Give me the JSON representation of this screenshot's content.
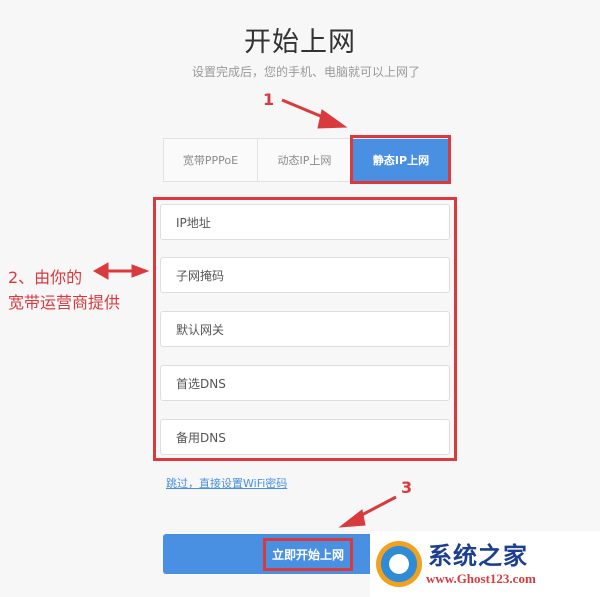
{
  "header": {
    "title": "开始上网",
    "subtitle": "设置完成后，您的手机、电脑就可以上网了"
  },
  "tabs": [
    {
      "label": "宽带PPPoE",
      "active": false
    },
    {
      "label": "动态IP上网",
      "active": false
    },
    {
      "label": "静态IP上网",
      "active": true
    }
  ],
  "form": {
    "fields": [
      {
        "placeholder": "IP地址"
      },
      {
        "placeholder": "子网掩码"
      },
      {
        "placeholder": "默认网关"
      },
      {
        "placeholder": "首选DNS"
      },
      {
        "placeholder": "备用DNS"
      }
    ],
    "skip_link": "跳过，直接设置WiFi密码",
    "submit_label": "立即开始上网"
  },
  "annotations": {
    "step1": "1",
    "step2_line1": "2、由你的",
    "step2_line2": "宽带运营商提供",
    "step3": "3"
  },
  "watermark": {
    "title": "系统之家",
    "url": "www.Ghost123.com"
  },
  "colors": {
    "accent": "#4a90e2",
    "annotation_red": "#d93a3e",
    "background": "#f7f7f7"
  }
}
